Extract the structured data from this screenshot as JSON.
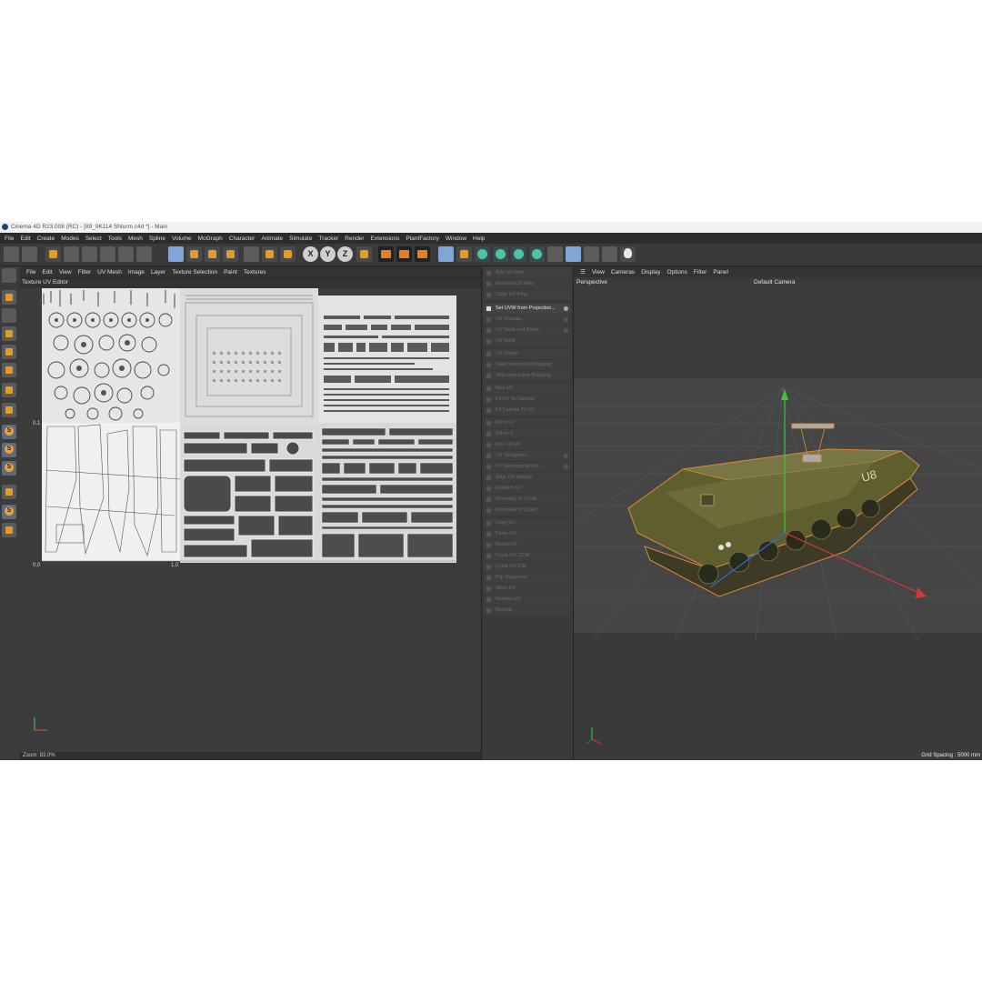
{
  "window": {
    "title": "Cinema 4D R23.008 (RC) - [89_9K114 Shturm.c4d *] - Main"
  },
  "menubar": [
    "File",
    "Edit",
    "Create",
    "Modes",
    "Select",
    "Tools",
    "Mesh",
    "Spline",
    "Volume",
    "MoGraph",
    "Character",
    "Animate",
    "Simulate",
    "Tracker",
    "Render",
    "Extensions",
    "PlantFactory",
    "Window",
    "Help"
  ],
  "toolbar": {
    "axis_x": "X",
    "axis_y": "Y",
    "axis_z": "Z"
  },
  "uv_editor": {
    "menu": [
      "File",
      "Edit",
      "View",
      "Filter",
      "UV Mesh",
      "Image",
      "Layer",
      "Texture Selection",
      "Paint",
      "Textures"
    ],
    "title": "Texture UV Editor",
    "tick_left": "0,1",
    "tick_origin": "0,0",
    "tick_right": "1,0",
    "zoom": "Zoom: 83.0%"
  },
  "uv_commands": [
    {
      "label": "Add UV Pins",
      "active": false
    },
    {
      "label": "Remove UV Pins",
      "active": false
    },
    {
      "label": "Clear UV Pins",
      "active": false
    },
    {
      "label": "Set UVW from Projection...",
      "active": true
    },
    {
      "label": "UV Unwrap...",
      "active": false
    },
    {
      "label": "UV Weld and Relax...",
      "active": false
    },
    {
      "label": "UV Weld",
      "active": false
    },
    {
      "label": "UV Peeler",
      "active": false
    },
    {
      "label": "Start Interactive Mapping",
      "active": false
    },
    {
      "label": "Stop Interactive Mapping",
      "active": false
    },
    {
      "label": "Max UV",
      "active": false
    },
    {
      "label": "Fit UV To Canvas",
      "active": false
    },
    {
      "label": "Fit Canvas To UV",
      "active": false
    },
    {
      "label": "Mirror U",
      "active": false
    },
    {
      "label": "Mirror V",
      "active": false
    },
    {
      "label": "Line Up UV",
      "active": false
    },
    {
      "label": "UV Straighten...",
      "active": false
    },
    {
      "label": "UV Rectangularize...",
      "active": false
    },
    {
      "label": "Align UV Islands",
      "active": false
    },
    {
      "label": "Unstitch UV",
      "active": false
    },
    {
      "label": "Boundary to Circle",
      "active": false
    },
    {
      "label": "Boundary to Quad",
      "active": false
    },
    {
      "label": "Copy UV",
      "active": false
    },
    {
      "label": "Paste UV",
      "active": false
    },
    {
      "label": "Reset UV",
      "active": false
    },
    {
      "label": "Cycle UV CCW",
      "active": false
    },
    {
      "label": "Cycle UV CW",
      "active": false
    },
    {
      "label": "Flip Sequence",
      "active": false
    },
    {
      "label": "Store UV",
      "active": false
    },
    {
      "label": "Restore UV",
      "active": false
    },
    {
      "label": "Remap...",
      "active": false
    }
  ],
  "viewport": {
    "menu": [
      "View",
      "Cameras",
      "Display",
      "Options",
      "Filter",
      "Panel"
    ],
    "projection": "Perspective",
    "camera": "Default Camera",
    "grid_spacing": "Grid Spacing : 5000 mm",
    "vehicle_number": "U8"
  },
  "colors": {
    "accent": "#e39b2a",
    "panel": "#333333",
    "vehicle": "#6b6a35",
    "selection": "#e08a3a"
  }
}
